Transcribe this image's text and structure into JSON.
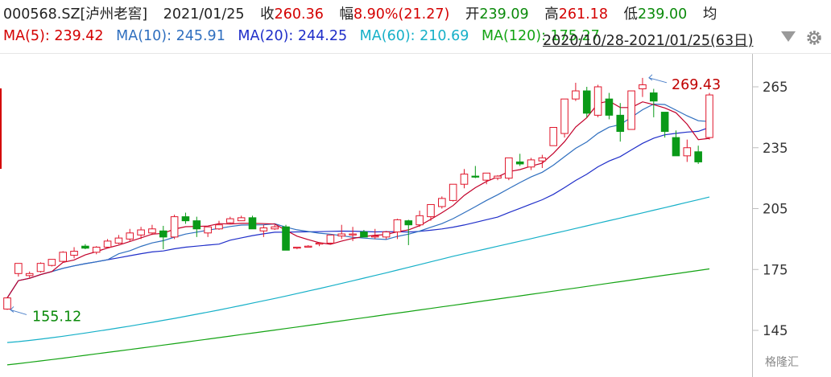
{
  "header": {
    "code": "000568.SZ",
    "name": "[泸州老窖]",
    "date": "2021/01/25",
    "close_label": "收",
    "close": "260.36",
    "change_label": "幅",
    "change": "8.90%(21.27)",
    "open_label": "开",
    "open": "239.09",
    "high_label": "高",
    "high": "261.18",
    "low_label": "低",
    "low": "239.00",
    "avg_label": "均"
  },
  "ma": [
    {
      "label": "MA(5): 239.42",
      "color": "#d40000"
    },
    {
      "label": "MA(10): 245.91",
      "color": "#2f6fbf"
    },
    {
      "label": "MA(20): 244.25",
      "color": "#1f2ec9"
    },
    {
      "label": "MA(60): 210.69",
      "color": "#16b0c8"
    },
    {
      "label": "MA(120): 175.27",
      "color": "#13a313"
    }
  ],
  "range_label": "2020/10/28-2021/01/25(63日)",
  "watermark": "格隆汇",
  "chart_data": {
    "type": "candlestick",
    "ylim": [
      145,
      275
    ],
    "yticks": [
      265,
      235,
      205,
      175,
      145
    ],
    "annotations": {
      "high": "269.43",
      "low": "155.12"
    },
    "candles": [
      [
        155.5,
        161.5,
        155.1,
        161.0
      ],
      [
        173,
        178,
        171.5,
        178
      ],
      [
        172,
        174,
        171,
        173
      ],
      [
        174,
        178.5,
        173.5,
        178
      ],
      [
        177,
        180,
        176.5,
        180
      ],
      [
        179,
        184,
        178.5,
        183.5
      ],
      [
        182,
        186,
        180.5,
        184
      ],
      [
        186.5,
        187.5,
        185,
        185.5
      ],
      [
        183.5,
        186.5,
        182.5,
        186
      ],
      [
        186,
        190,
        185.5,
        189
      ],
      [
        188,
        192,
        187.5,
        190.5
      ],
      [
        190,
        195,
        189,
        193
      ],
      [
        192,
        196,
        190,
        194.5
      ],
      [
        193,
        197,
        192,
        195
      ],
      [
        194,
        196.5,
        185,
        191
      ],
      [
        191,
        202,
        190,
        201
      ],
      [
        201,
        203,
        197.5,
        199
      ],
      [
        199,
        201,
        191,
        195
      ],
      [
        193,
        196,
        191,
        196
      ],
      [
        195,
        199,
        194.5,
        197
      ],
      [
        198,
        201,
        197.5,
        200
      ],
      [
        199,
        201.5,
        199,
        200.5
      ],
      [
        200.5,
        201.5,
        195,
        195
      ],
      [
        194,
        197,
        191,
        195.5
      ],
      [
        195,
        197,
        194.5,
        196
      ],
      [
        196,
        197,
        184.5,
        184.5
      ],
      [
        185.5,
        186,
        185,
        186
      ],
      [
        186,
        187,
        186,
        186.5
      ],
      [
        187.5,
        188,
        186.5,
        188
      ],
      [
        188,
        192,
        187.5,
        192
      ],
      [
        191.5,
        197,
        190,
        192.5
      ],
      [
        192,
        196,
        189,
        192.5
      ],
      [
        193.5,
        194.5,
        191,
        191
      ],
      [
        191,
        195,
        190,
        191.5
      ],
      [
        191,
        194,
        190,
        193.5
      ],
      [
        193.5,
        200,
        190,
        199.5
      ],
      [
        199,
        199.5,
        187,
        197
      ],
      [
        197,
        204,
        196,
        201.5
      ],
      [
        201,
        207,
        199,
        207
      ],
      [
        206,
        211,
        205,
        210
      ],
      [
        209,
        216,
        208.5,
        217
      ],
      [
        217,
        224.5,
        215,
        222
      ],
      [
        221,
        226,
        220,
        220.5
      ],
      [
        219,
        222,
        217,
        222.5
      ],
      [
        220,
        221.5,
        219,
        221
      ],
      [
        220,
        227.5,
        219,
        230
      ],
      [
        228,
        232,
        226,
        227
      ],
      [
        225.5,
        230,
        224,
        229
      ],
      [
        228.5,
        231.5,
        225,
        230
      ],
      [
        236,
        245,
        236,
        245
      ],
      [
        242,
        259,
        240,
        259
      ],
      [
        259,
        267,
        258,
        263
      ],
      [
        263,
        265,
        250,
        252
      ],
      [
        251,
        266,
        250,
        265
      ],
      [
        259,
        262,
        249,
        251
      ],
      [
        251,
        257,
        238,
        243
      ],
      [
        244,
        263,
        244,
        263
      ],
      [
        264,
        269.4,
        260,
        266
      ],
      [
        262,
        264,
        250,
        258
      ],
      [
        252.5,
        252.5,
        240,
        243
      ],
      [
        240,
        243.5,
        235,
        231
      ],
      [
        231,
        239,
        228,
        235
      ],
      [
        233,
        236,
        227,
        228
      ]
    ],
    "last_candle": [
      240,
      262,
      239,
      261
    ]
  }
}
